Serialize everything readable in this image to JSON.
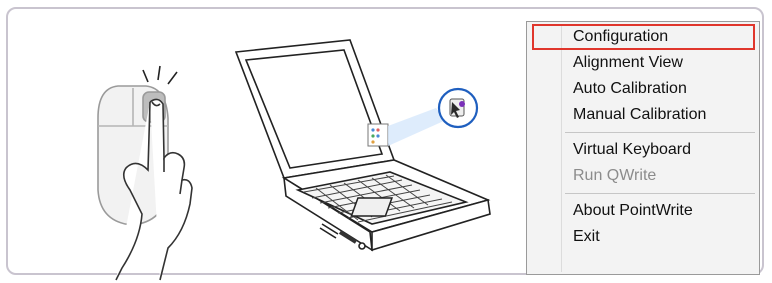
{
  "context_menu": {
    "items": [
      {
        "label": "Configuration",
        "enabled": true,
        "highlighted": true
      },
      {
        "label": "Alignment View",
        "enabled": true
      },
      {
        "label": "Auto Calibration",
        "enabled": true
      },
      {
        "label": "Manual Calibration",
        "enabled": true
      },
      {
        "label": "Virtual Keyboard",
        "enabled": true
      },
      {
        "label": "Run QWrite",
        "enabled": false
      },
      {
        "label": "About PointWrite",
        "enabled": true
      },
      {
        "label": "Exit",
        "enabled": true
      }
    ]
  },
  "illustration": {
    "left": "mouse-right-click-icon",
    "center": "laptop-with-tray-icon",
    "tray_icon": "pointwrite-tray-icon"
  },
  "colors": {
    "panel_border": "#c9c4cf",
    "highlight_border": "#e0362c",
    "disabled_text": "#8c8c8c",
    "tray_badge": "#1f5fbf"
  }
}
